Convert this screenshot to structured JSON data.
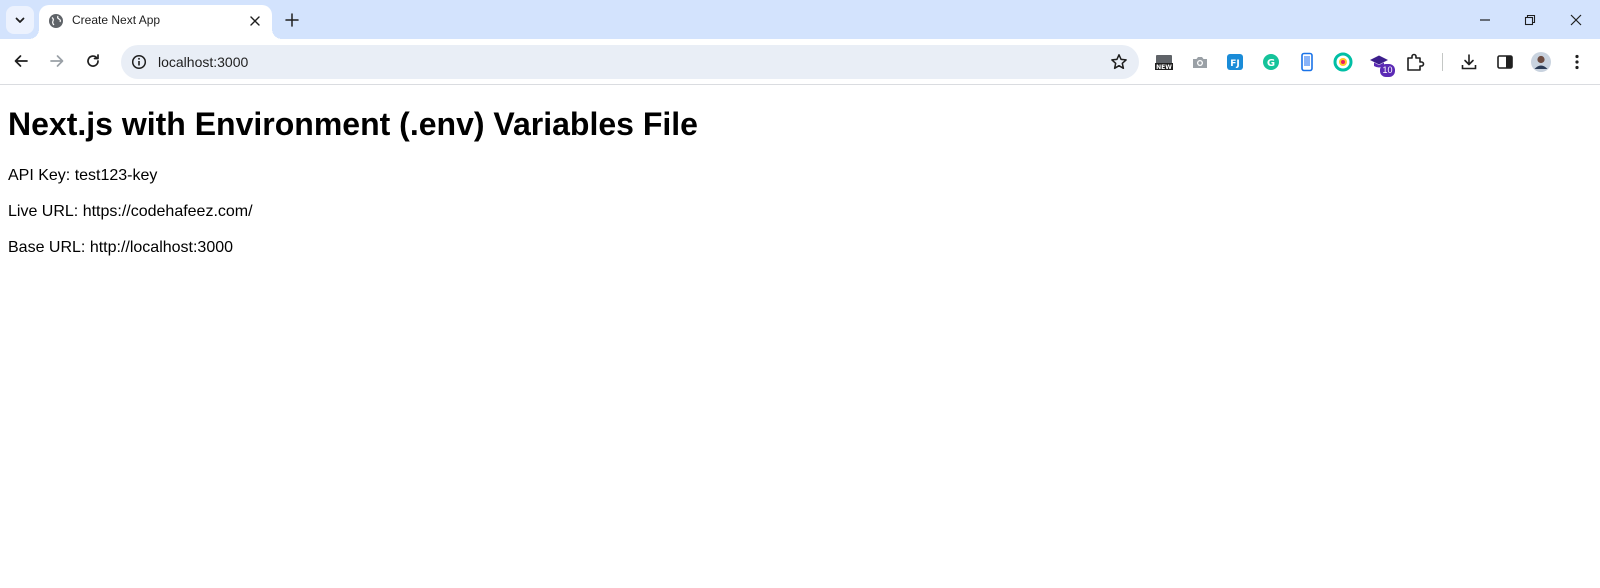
{
  "browser": {
    "tab": {
      "title": "Create Next App"
    },
    "address_bar": {
      "url": "localhost:3000"
    },
    "extensions": [
      {
        "name": "new-extension-icon",
        "label": "NEW"
      },
      {
        "name": "camera-icon"
      },
      {
        "name": "fj-extension-icon",
        "label": "FJ"
      },
      {
        "name": "grammarly-icon",
        "label": "G"
      },
      {
        "name": "mobile-view-icon"
      },
      {
        "name": "color-picker-icon"
      },
      {
        "name": "graduation-cap-icon",
        "badge": "10"
      },
      {
        "name": "extensions-puzzle-icon"
      }
    ],
    "colors": {
      "tabstrip": "#d3e3fd",
      "omnibox": "#e9eef6",
      "accent_badge": "#5b2ab5"
    }
  },
  "page": {
    "heading": "Next.js with Environment (.env) Variables File",
    "lines": {
      "api_key": "API Key: test123-key",
      "live_url": "Live URL: https://codehafeez.com/",
      "base_url": "Base URL: http://localhost:3000"
    }
  }
}
